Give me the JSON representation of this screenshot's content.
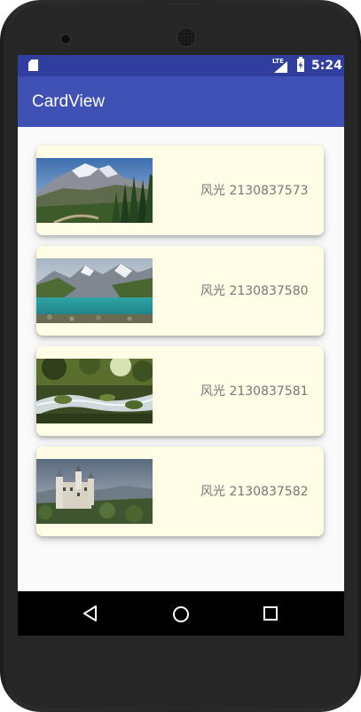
{
  "status_bar": {
    "network": "LTE",
    "time": "5:24",
    "icons": [
      "sd-card-icon",
      "signal-icon",
      "battery-charging-icon"
    ]
  },
  "app_bar": {
    "title": "CardView"
  },
  "cards": [
    {
      "label": "风光 2130837573",
      "image": "mountain-forest-landscape"
    },
    {
      "label": "风光 2130837580",
      "image": "mountain-lake-landscape"
    },
    {
      "label": "风光 2130837581",
      "image": "forest-stream-landscape"
    },
    {
      "label": "风光 2130837582",
      "image": "castle-landscape"
    }
  ],
  "nav_bar": {
    "icons": [
      "back-icon",
      "home-icon",
      "recents-icon"
    ]
  },
  "colors": {
    "status_bar": "#303F9F",
    "app_bar": "#3F51B5",
    "card_background": "#FFFDE6",
    "content_background": "#FAFAFA"
  }
}
